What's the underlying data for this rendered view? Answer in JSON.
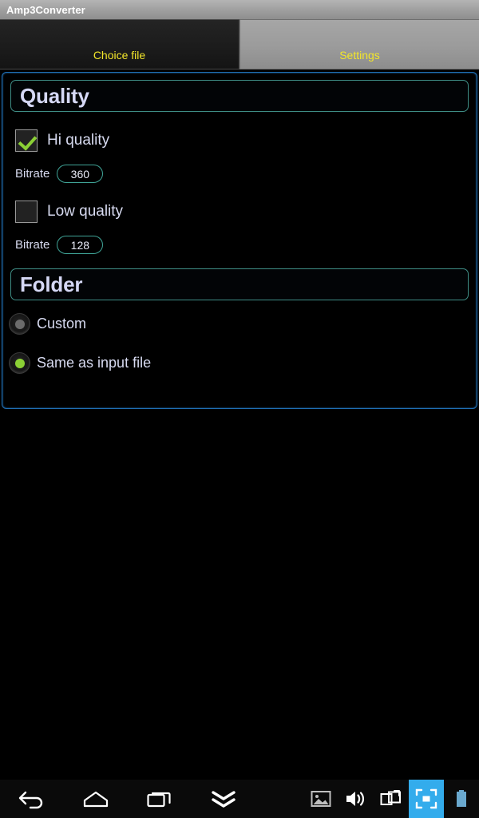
{
  "window": {
    "title": "Amp3Converter"
  },
  "tabs": [
    {
      "id": "choice-file",
      "label": "Choice file",
      "active": false
    },
    {
      "id": "settings",
      "label": "Settings",
      "active": true
    }
  ],
  "settings": {
    "quality": {
      "header": "Quality",
      "options": [
        {
          "id": "hi-quality",
          "label": "Hi quality",
          "checked": true,
          "bitrate_label": "Bitrate",
          "bitrate_value": "360"
        },
        {
          "id": "low-quality",
          "label": "Low quality",
          "checked": false,
          "bitrate_label": "Bitrate",
          "bitrate_value": "128"
        }
      ]
    },
    "folder": {
      "header": "Folder",
      "options": [
        {
          "id": "custom",
          "label": "Custom",
          "selected": false
        },
        {
          "id": "same-as-input-file",
          "label": "Same as input file",
          "selected": true
        }
      ]
    }
  },
  "navbar": {
    "buttons": [
      {
        "id": "back",
        "icon": "back-arrow-icon"
      },
      {
        "id": "home",
        "icon": "home-icon"
      },
      {
        "id": "recents",
        "icon": "recents-icon"
      },
      {
        "id": "hide",
        "icon": "chevron-double-down-icon"
      }
    ],
    "system_buttons": [
      {
        "id": "screenshot-gallery",
        "icon": "image-icon",
        "active": false
      },
      {
        "id": "volume",
        "icon": "volume-icon",
        "active": false
      },
      {
        "id": "cast-screen",
        "icon": "cast-screen-icon",
        "active": false
      },
      {
        "id": "fullscreen",
        "icon": "fullscreen-icon",
        "active": true
      },
      {
        "id": "battery",
        "icon": "battery-icon",
        "active": false
      }
    ]
  },
  "colors": {
    "accent_blue": "#33acec",
    "panel_border": "#1f6fb5",
    "box_border": "#3f8e86",
    "tab_text": "#f2e62a",
    "check_green": "#8bd035",
    "label_text": "#d7daf0",
    "background": "#000000"
  }
}
